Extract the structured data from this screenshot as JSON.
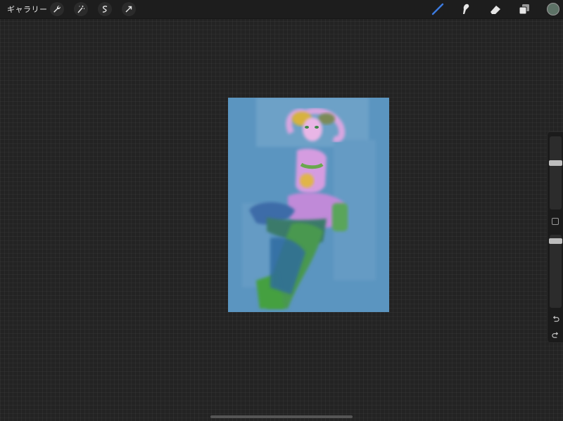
{
  "topbar": {
    "gallery_label": "ギャラリー",
    "left_tools": [
      "wrench-icon",
      "magic-wand-icon",
      "selection-icon",
      "transform-arrow-icon"
    ],
    "right_tools": [
      "brush-icon",
      "smudge-icon",
      "eraser-icon",
      "layers-icon"
    ],
    "active_tool": "brush-icon",
    "accent_color": "#3c7be0",
    "current_color": "#5d7266"
  },
  "canvas": {
    "background_color": "#5b95c0",
    "content": "artwork-figure-dancing"
  },
  "sidebar": {
    "brush_size_level": 0.65,
    "opacity_level": 0.95,
    "buttons": [
      "modify-square-icon",
      "undo-icon",
      "redo-icon"
    ]
  }
}
